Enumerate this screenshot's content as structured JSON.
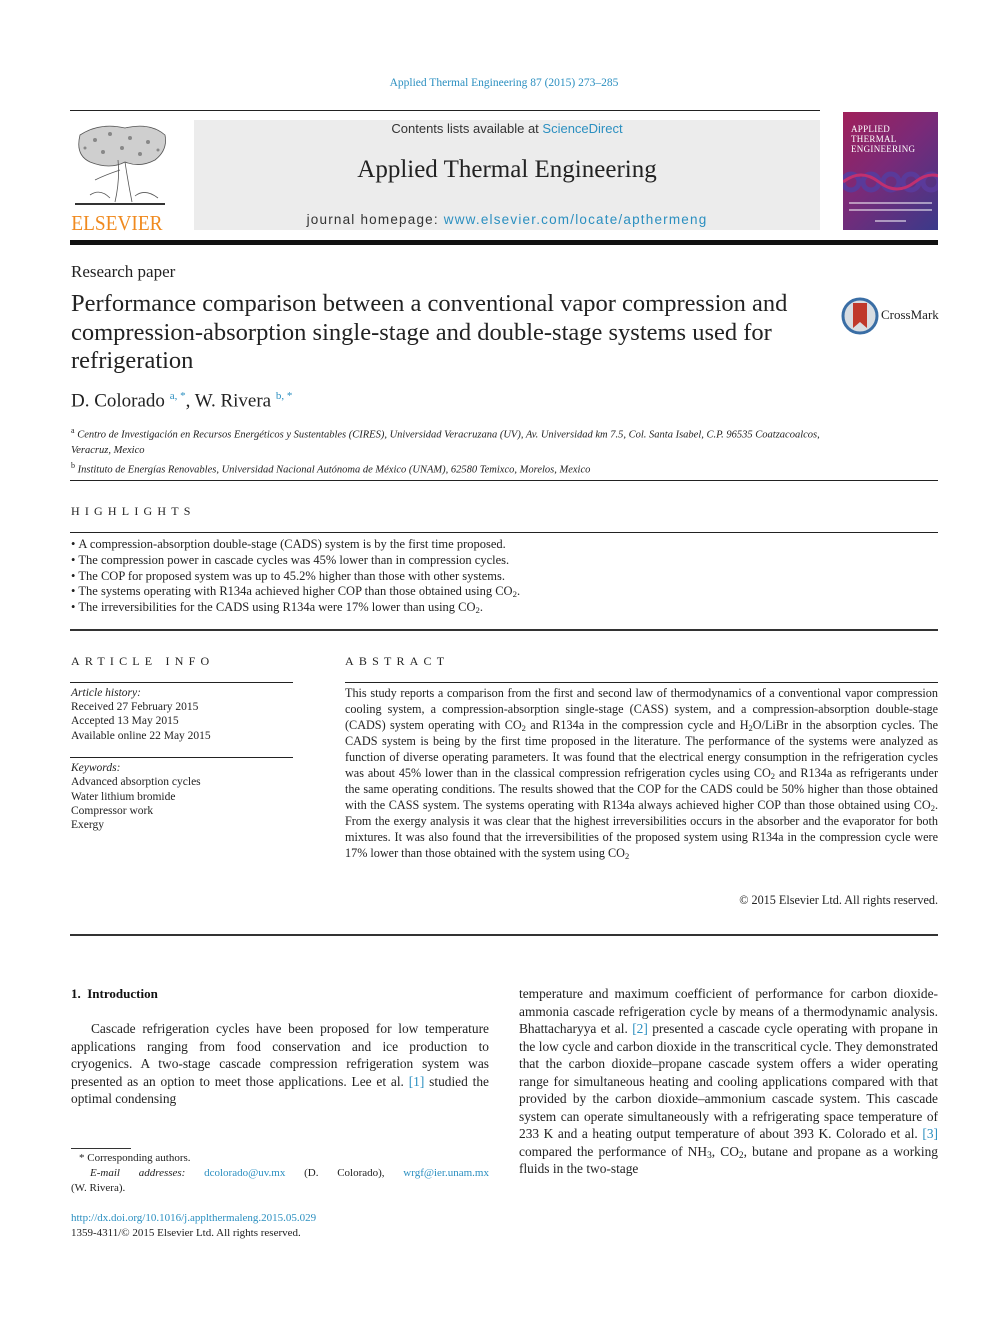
{
  "journal_ref": "Applied Thermal Engineering 87 (2015) 273–285",
  "header": {
    "publisher_logo_text": "ELSEVIER",
    "contents_prefix": "Contents lists available at ",
    "contents_link": "ScienceDirect",
    "journal_title": "Applied Thermal Engineering",
    "homepage_prefix": "journal homepage: ",
    "homepage_link": "www.elsevier.com/locate/apthermeng",
    "cover_title_lines": [
      "Applied",
      "Thermal",
      "Engineering"
    ],
    "colors": {
      "link": "#2b8fc0",
      "elsevier_orange": "#f08a1f",
      "banner_bg": "#ececec"
    }
  },
  "article": {
    "type": "Research paper",
    "title": "Performance comparison between a conventional vapor compression and compression-absorption single-stage and double-stage systems used for refrigeration",
    "crossmark_label": "CrossMark",
    "authors": [
      {
        "name": "D. Colorado",
        "marks": "a, *"
      },
      {
        "name": "W. Rivera",
        "marks": "b, *"
      }
    ],
    "author_separator": ", ",
    "affiliations": [
      {
        "mark": "a",
        "text": "Centro de Investigación en Recursos Energéticos y Sustentables (CIRES), Universidad Veracruzana (UV), Av. Universidad km 7.5, Col. Santa Isabel, C.P. 96535 Coatzacoalcos, Veracruz, Mexico"
      },
      {
        "mark": "b",
        "text": "Instituto de Energías Renovables, Universidad Nacional Autónoma de México (UNAM), 62580 Temixco, Morelos, Mexico"
      }
    ]
  },
  "highlights": {
    "heading": "HIGHLIGHTS",
    "items": [
      {
        "text": "A compression-absorption double-stage (CADS) system is by the first time proposed.",
        "tail_sub": "",
        "tail": ""
      },
      {
        "text": "The compression power in cascade cycles was 45% lower than in compression cycles.",
        "tail_sub": "",
        "tail": ""
      },
      {
        "text": "The COP for proposed system was up to 45.2% higher than those with other systems.",
        "tail_sub": "",
        "tail": ""
      },
      {
        "text": "The systems operating with R134a achieved higher COP than those obtained using CO",
        "tail_sub": "2",
        "tail": "."
      },
      {
        "text": "The irreversibilities for the CADS using R134a were 17% lower than using CO",
        "tail_sub": "2",
        "tail": "."
      }
    ]
  },
  "article_info": {
    "heading": "ARTICLE INFO",
    "history_label": "Article history:",
    "history": [
      "Received 27 February 2015",
      "Accepted 13 May 2015",
      "Available online 22 May 2015"
    ],
    "keywords_label": "Keywords:",
    "keywords": [
      "Advanced absorption cycles",
      "Water lithium bromide",
      "Compressor work",
      "Exergy"
    ]
  },
  "abstract": {
    "heading": "ABSTRACT",
    "segments": [
      "This study reports a comparison from the first and second law of thermodynamics of a conventional vapor compression cooling system, a compression-absorption single-stage (CASS) system, and a compression-absorption double-stage (CADS) system operating with CO",
      "2",
      " and R134a in the compression cycle and H",
      "2",
      "O/LiBr in the absorption cycles. The CADS system is being by the first time proposed in the literature. The performance of the systems were analyzed as function of diverse operating parameters. It was found that the electrical energy consumption in the refrigeration cycles was about 45% lower than in the classical compression refrigeration cycles using CO",
      "2",
      " and R134a as refrigerants under the same operating conditions. The results showed that the COP for the CADS could be 50% higher than those obtained with the CASS system. The systems operating with R134a always achieved higher COP than those obtained using CO",
      "2",
      ". From the exergy analysis it was clear that the highest irreversibilities occurs in the absorber and the evaporator for both mixtures. It was also found that the irreversibilities of the proposed system using R134a in the compression cycle were 17% lower than those obtained with the system using CO",
      "2"
    ],
    "copyright": "© 2015 Elsevier Ltd. All rights reserved."
  },
  "body": {
    "section_number": "1.",
    "section_title": "Introduction",
    "left_col": {
      "before_ref": "Cascade refrigeration cycles have been proposed for low temperature applications ranging from food conservation and ice production to cryogenics. A two-stage cascade compression refrigeration system was presented as an option to meet those applications. Lee et al. ",
      "ref": "[1]",
      "after_ref": " studied the optimal condensing"
    },
    "right_col": {
      "p1": "temperature and maximum coefficient of performance for carbon dioxide-ammonia cascade refrigeration cycle by means of a thermodynamic analysis. Bhattacharyya et al. ",
      "ref2": "[2]",
      "p2": " presented a cascade cycle operating with propane in the low cycle and carbon dioxide in the transcritical cycle. They demonstrated that the carbon dioxide–propane cascade system offers a wider operating range for simultaneous heating and cooling applications compared with that provided by the carbon dioxide–ammonium cascade system. This cascade system can operate simultaneously with a refrigerating space temperature of 233 K and a heating output temperature of about 393 K. Colorado et al. ",
      "ref3": "[3]",
      "p3": " compared the performance of NH",
      "sub1": "3",
      "p4": ", CO",
      "sub2": "2",
      "p5": ", butane and propane as a working fluids in the two-stage"
    }
  },
  "footnotes": {
    "corresponding": "* Corresponding authors.",
    "email_label": "E-mail addresses:",
    "email1": "dcolorado@uv.mx",
    "email1_name": " (D. Colorado), ",
    "email2": "wrgf@ier.unam.mx",
    "email2_name": "(W. Rivera).",
    "doi": "http://dx.doi.org/10.1016/j.applthermaleng.2015.05.029",
    "issn_line": "1359-4311/© 2015 Elsevier Ltd. All rights reserved."
  }
}
